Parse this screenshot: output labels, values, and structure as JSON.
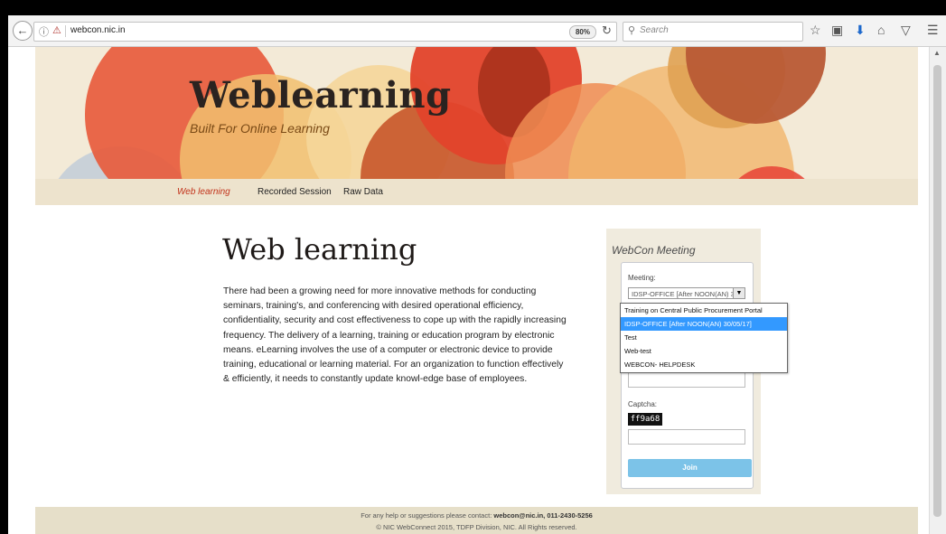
{
  "browser": {
    "url": "webcon.nic.in",
    "zoom": "80%",
    "search_placeholder": "Search"
  },
  "site": {
    "title": "Weblearning",
    "tagline": "Built For Online Learning"
  },
  "nav": {
    "items": [
      {
        "label": "Web learning",
        "active": true
      },
      {
        "label": "Recorded Session",
        "active": false
      },
      {
        "label": "Raw Data",
        "active": false
      }
    ]
  },
  "main": {
    "heading": "Web learning",
    "intro": "There had been a growing need for more innovative methods for conducting seminars, training's, and conferencing with desired operational efficiency, confidentiality, security and cost effectiveness to cope up with the rapidly increasing frequency. The delivery of a learning, training or education program by electronic means. eLearning involves the use of a computer or electronic device to provide training, educational or learning material. For an organization to function effectively & efficiently, it needs to constantly update knowl-edge base of employees."
  },
  "widget": {
    "title": "WebCon Meeting",
    "meeting_label": "Meeting:",
    "selected_meeting": "IDSP-OFFICE [After NOON(AN) 30/05/17]",
    "options": [
      "Training on Central Public Procurement Portal",
      "IDSP-OFFICE [After NOON(AN) 30/05/17]",
      "Test",
      "Web-test",
      "WEBCON- HELPDESK"
    ],
    "selected_index": 1,
    "captcha_label": "Captcha:",
    "captcha_value": "ff9a68",
    "join_label": "Join"
  },
  "footer": {
    "line1_prefix": "For any help or suggestions please contact: ",
    "contact": "webcon@nic.in, 011-2430-5256",
    "line2": "© NIC WebConnect 2015, TDFP Division, NIC. All Rights reserved."
  },
  "colors": {
    "banner_bg": "#f3ead7",
    "nav_bg": "#ede3cd",
    "active_nav": "#c2331b",
    "join_button": "#7cc3e8",
    "dropdown_highlight": "#3399ff"
  },
  "icons": [
    "back-arrow-icon",
    "info-icon",
    "insecure-lock-icon",
    "reload-icon",
    "search-icon",
    "bookmark-star-icon",
    "reading-list-icon",
    "download-icon",
    "home-icon",
    "pocket-icon",
    "menu-icon"
  ]
}
